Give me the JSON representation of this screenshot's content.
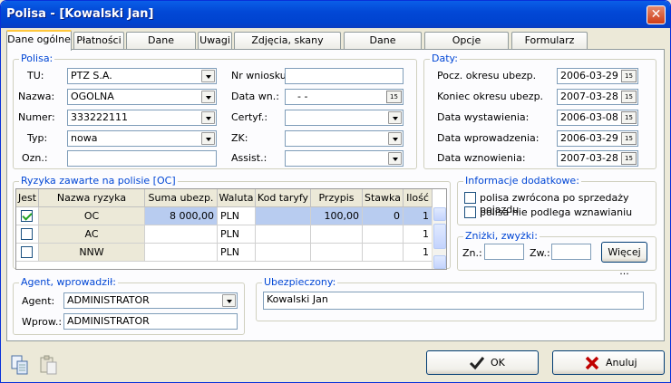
{
  "window": {
    "title": "Polisa - [Kowalski Jan]",
    "close": "✕"
  },
  "tabs": [
    "Dane ogólne",
    "Płatności",
    "Dane pojazdu",
    "Uwagi",
    "Zdjęcia, skany druków",
    "Dane brokerskie",
    "Opcje dodatkowe",
    "Formularz polisy"
  ],
  "polisa": {
    "legend": "Polisa:",
    "tu_label": "TU:",
    "tu_value": "PTZ S.A.",
    "nazwa_label": "Nazwa:",
    "nazwa_value": "OGOLNA",
    "numer_label": "Numer:",
    "numer_value": "333222111",
    "typ_label": "Typ:",
    "typ_value": "nowa",
    "ozn_label": "Ozn.:",
    "ozn_value": "",
    "nr_wniosku_label": "Nr wniosku:",
    "nr_wniosku_value": "",
    "data_wn_label": "Data wn.:",
    "data_wn_value": " -  - ",
    "certyf_label": "Certyf.:",
    "zk_label": "ZK:",
    "assist_label": "Assist.:"
  },
  "daty": {
    "legend": "Daty:",
    "items": [
      {
        "label": "Pocz. okresu ubezp.",
        "value": "2006-03-29"
      },
      {
        "label": "Koniec okresu ubezp.",
        "value": "2007-03-28"
      },
      {
        "label": "Data wystawienia:",
        "value": "2006-03-08"
      },
      {
        "label": "Data wprowadzenia:",
        "value": "2006-03-29"
      },
      {
        "label": "Data wznowienia:",
        "value": "2007-03-28"
      }
    ],
    "cal_icon": "15"
  },
  "ryzyka": {
    "legend": "Ryzyka zawarte na polisie [OC]",
    "columns": [
      "Jest",
      "Nazwa ryzyka",
      "Suma ubezp.",
      "Waluta",
      "Kod taryfy",
      "Przypis",
      "Stawka",
      "Ilość"
    ],
    "rows": [
      {
        "jest": true,
        "nazwa": "OC",
        "suma": "8 000,00",
        "waluta": "PLN",
        "kod": "",
        "przypis": "100,00",
        "stawka": "0",
        "ilosc": "1"
      },
      {
        "jest": false,
        "nazwa": "AC",
        "suma": "",
        "waluta": "PLN",
        "kod": "",
        "przypis": "",
        "stawka": "",
        "ilosc": "1"
      },
      {
        "jest": false,
        "nazwa": "NNW",
        "suma": "",
        "waluta": "PLN",
        "kod": "",
        "przypis": "",
        "stawka": "",
        "ilosc": "1"
      }
    ]
  },
  "info": {
    "legend": "Informacje dodatkowe:",
    "opt1": "polisa zwrócona po sprzedaży pojazdu",
    "opt2": "polisa nie podlega wznawianiu"
  },
  "znizki": {
    "legend": "Zniżki, zwyżki:",
    "zn_label": "Zn.:",
    "zw_label": "Zw.:",
    "wiecej": "Więcej ..."
  },
  "agent": {
    "legend": "Agent, wprowadził:",
    "agent_label": "Agent:",
    "agent_value": "ADMINISTRATOR",
    "wprow_label": "Wprow.:",
    "wprow_value": "ADMINISTRATOR"
  },
  "ubezpieczony": {
    "legend": "Ubezpieczony:",
    "value": "Kowalski Jan"
  },
  "buttons": {
    "ok": "OK",
    "anuluj": "Anuluj"
  }
}
